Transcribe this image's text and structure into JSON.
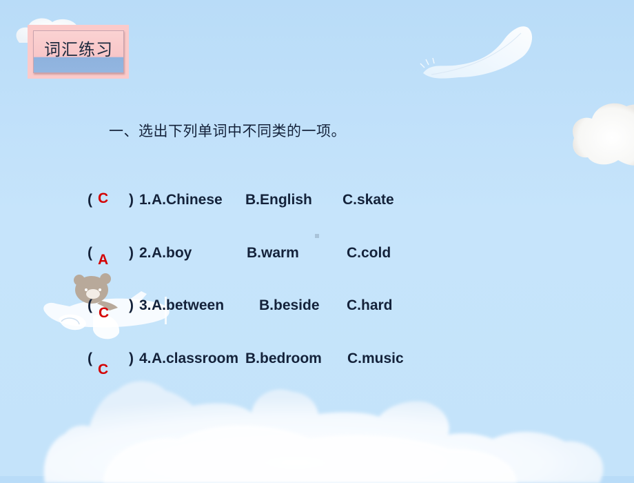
{
  "slide": {
    "section_title": "词汇练习",
    "instruction": "一、选出下列单词中不同类的一项。",
    "questions": [
      {
        "open_paren": "(",
        "answer": "C",
        "close_paren": ")",
        "number": "1.",
        "option_a": "A.Chinese",
        "option_b": "B.English",
        "option_c": "C.skate"
      },
      {
        "open_paren": "(",
        "answer": "A",
        "close_paren": ")",
        "number": "2.",
        "option_a": "A.boy",
        "option_b": "B.warm",
        "option_c": "C.cold"
      },
      {
        "open_paren": "(",
        "answer": "C",
        "close_paren": ")",
        "number": "3.",
        "option_a": "A.between",
        "option_b": "B.beside",
        "option_c": "C.hard"
      },
      {
        "open_paren": "(",
        "answer": "C",
        "close_paren": ")",
        "number": "4.",
        "option_a": "A.classroom",
        "option_b": "B.bedroom",
        "option_c": "C.music"
      }
    ],
    "colors": {
      "background": "#c4e3fa",
      "text": "#14223a",
      "answer": "#d40000",
      "badge_pink": "#fbcaca",
      "badge_blue": "#93b6e0"
    },
    "decorations": [
      "cloud-icon",
      "feather-icon",
      "bear-airplane-icon"
    ]
  }
}
